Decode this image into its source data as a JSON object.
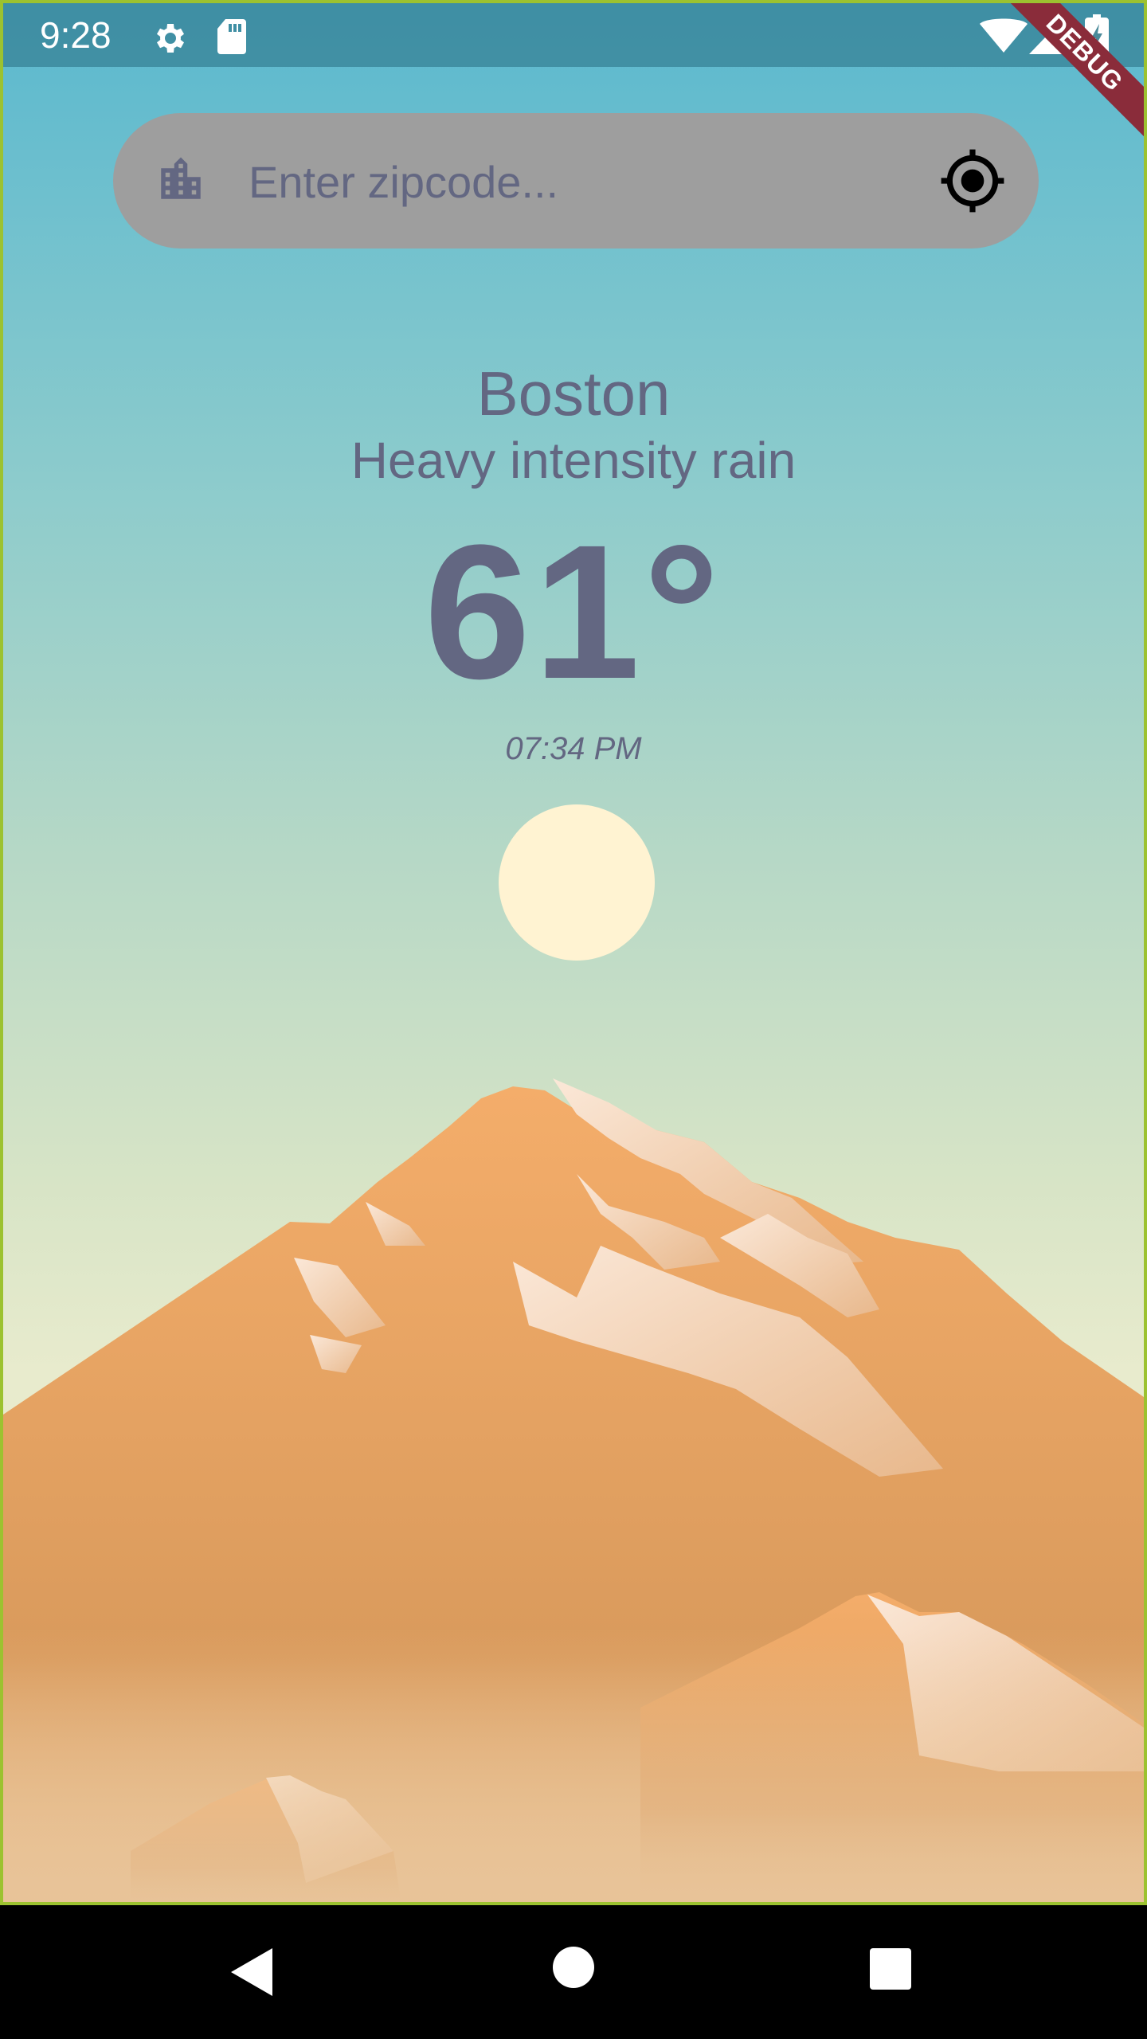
{
  "status_bar": {
    "time": "9:28",
    "icons": [
      "gear-icon",
      "sd-card-icon",
      "wifi-icon",
      "cell-signal-icon",
      "battery-charging-icon"
    ]
  },
  "debug_banner": "DEBUG",
  "search": {
    "placeholder": "Enter zipcode...",
    "value": "",
    "left_icon": "city-icon",
    "right_icon": "my-location-icon"
  },
  "weather": {
    "city": "Boston",
    "description": "Heavy intensity rain",
    "temperature": "61°",
    "time": "07:34 PM"
  },
  "colors": {
    "text": "#636782",
    "sky_top": "#5ab8cf",
    "sky_bottom": "#f0e7c8",
    "sun": "#fff3d2",
    "mountain": "#e0a060",
    "search_bg": "#9e9e9e"
  },
  "nav_bar": {
    "icons": [
      "back-icon",
      "home-icon",
      "recents-icon"
    ]
  }
}
